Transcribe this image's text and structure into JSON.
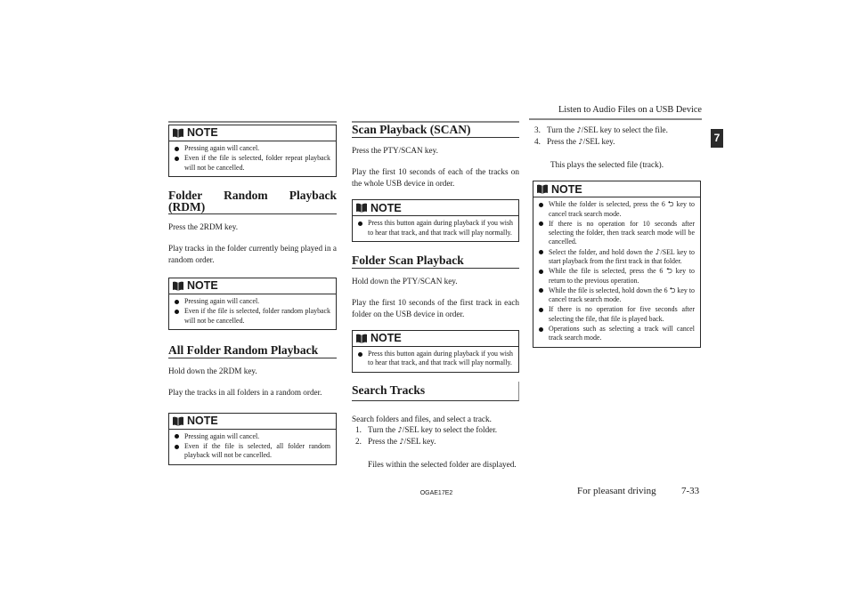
{
  "header": {
    "title": "Listen to Audio Files on a USB Device"
  },
  "chapter_tab": "7",
  "footer": {
    "code": "OGAE17E2",
    "section": "For pleasant driving",
    "page": "7-33"
  },
  "note_label": "NOTE",
  "col1": {
    "note1": {
      "items": [
        "Pressing again will cancel.",
        "Even if the file is selected, folder repeat playback will not be cancelled."
      ]
    },
    "folder_random": {
      "heading": "Folder Random Playback (RDM)",
      "p1": "Press the 2RDM key.",
      "p2": "Play tracks in the folder currently being played in a random order.",
      "note": {
        "items": [
          "Pressing again will cancel.",
          "Even if the file is selected, folder random playback will not be cancelled."
        ]
      }
    },
    "all_folder_random": {
      "heading": "All Folder Random Playback",
      "p1": "Hold down the 2RDM key.",
      "p2": "Play the tracks in all folders in a random order.",
      "note": {
        "items": [
          "Pressing again will cancel.",
          "Even if the file is selected, all folder random playback will not be cancelled."
        ]
      }
    }
  },
  "col2": {
    "scan": {
      "heading": "Scan Playback (SCAN)",
      "p1": "Press the PTY/SCAN key.",
      "p2": "Play the first 10 seconds of each of the tracks on the whole USB device in order.",
      "note": {
        "items": [
          "Press this button again during playback if you wish to hear that track, and that track will play normally."
        ]
      }
    },
    "folder_scan": {
      "heading": "Folder Scan Playback",
      "p1": "Hold down the PTY/SCAN key.",
      "p2": "Play the first 10 seconds of the first track in each folder on the USB device in order.",
      "note": {
        "items": [
          "Press this button again during playback if you wish to hear that track, and that track will play normally."
        ]
      }
    },
    "search": {
      "heading": "Search Tracks",
      "p1": "Search folders and files, and select a track.",
      "steps": [
        {
          "n": "1.",
          "pre": "Turn the ",
          "post": "/SEL key to select the folder."
        },
        {
          "n": "2.",
          "pre": "Press the ",
          "post": "/SEL key."
        }
      ],
      "result": "Files within the selected folder are displayed."
    }
  },
  "col3": {
    "steps": [
      {
        "n": "3.",
        "pre": "Turn the ",
        "post": "/SEL key to select the file."
      },
      {
        "n": "4.",
        "pre": "Press the ",
        "post": "/SEL key."
      }
    ],
    "result": "This plays the selected file (track).",
    "note": {
      "items": [
        {
          "pre": "While the folder is selected, press the 6 ",
          "post": " key to cancel track search mode."
        },
        {
          "pre": "If there is no operation for 10 seconds after selecting the folder, then track search mode will be cancelled.",
          "post": ""
        },
        {
          "pre": "Select the folder, and hold down the ",
          "post": "/SEL key to start playback from the first track in that folder."
        },
        {
          "pre": "While the file is selected, press the 6 ",
          "post": " key to return to the previous operation."
        },
        {
          "pre": "While the file is selected, hold down the 6 ",
          "post": " key to cancel track search mode."
        },
        {
          "pre": "If there is no operation for five seconds after selecting the file, that file is played back.",
          "post": ""
        },
        {
          "pre": "Operations such as selecting a track will cancel track search mode.",
          "post": ""
        }
      ]
    }
  },
  "icons": {
    "music_note": "♪",
    "return_arrow": "⮌"
  }
}
